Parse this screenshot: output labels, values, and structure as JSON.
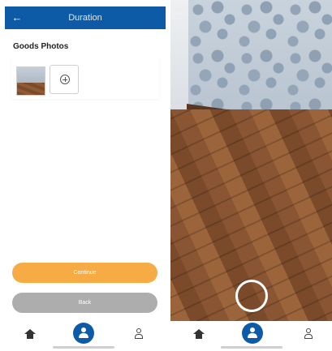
{
  "left_screen": {
    "header": {
      "title": "Duration",
      "back_icon": "arrow-left-icon"
    },
    "section_label": "Goods Photos",
    "photos": [
      {
        "type": "thumbnail"
      }
    ],
    "add_photo_icon": "add-circle-icon",
    "buttons": {
      "primary_label": "Continue",
      "secondary_label": "Back"
    },
    "colors": {
      "header": "#0d5aa7",
      "primary_button": "#f7a73a",
      "secondary_button": "#a9a9a9"
    }
  },
  "right_screen": {
    "close_icon": "close-icon",
    "shutter_icon": "shutter-button"
  },
  "bottom_nav": {
    "items": [
      {
        "icon": "home-icon"
      },
      {
        "icon": "user-circle-icon",
        "active": true
      },
      {
        "icon": "profile-icon"
      }
    ]
  }
}
